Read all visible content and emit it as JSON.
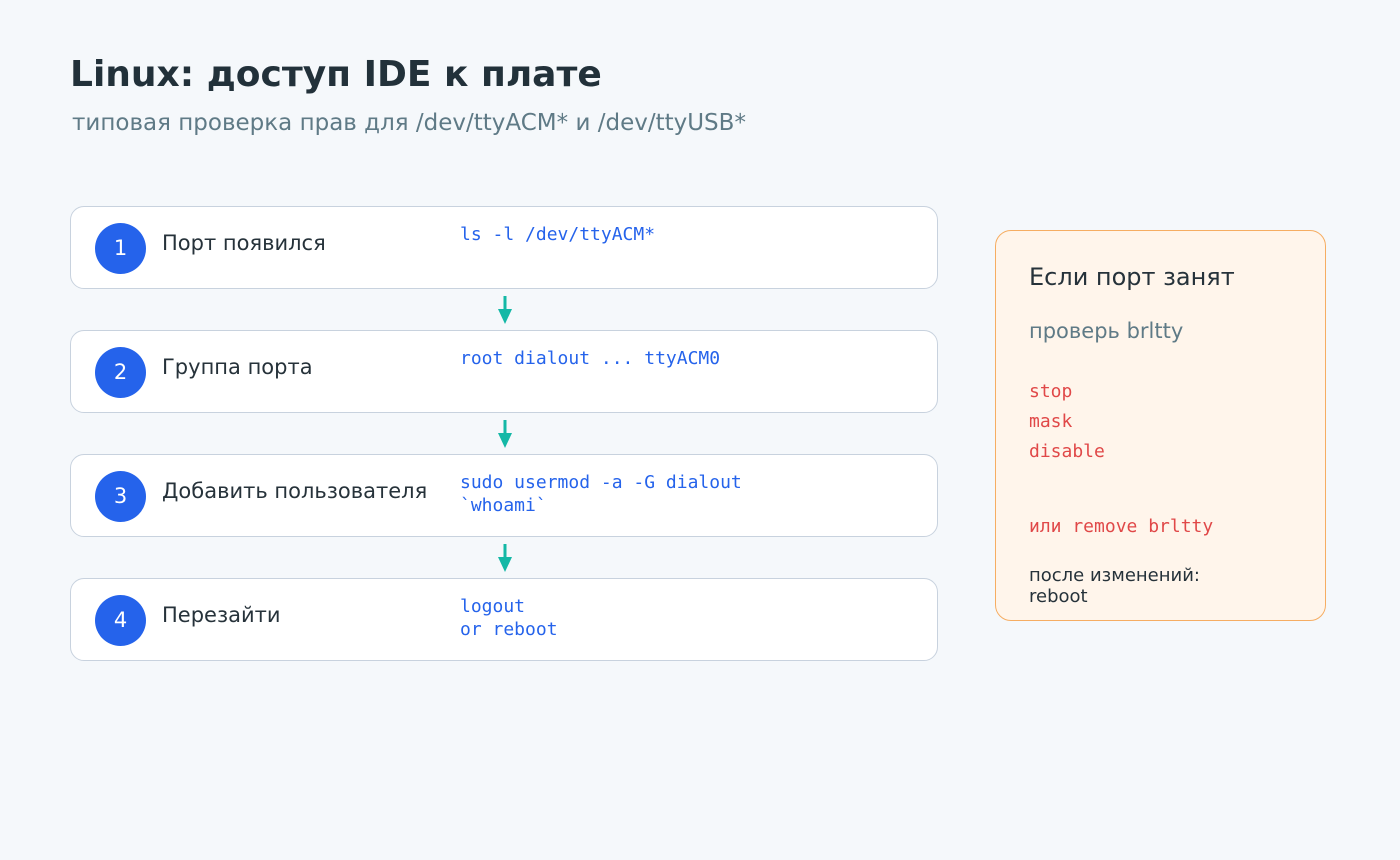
{
  "header": {
    "title": "Linux: доступ IDE к плате",
    "subtitle": "типовая проверка прав для /dev/ttyACM* и /dev/ttyUSB*"
  },
  "steps": [
    {
      "number": "1",
      "label": "Порт появился",
      "code": "ls -l /dev/ttyACM*"
    },
    {
      "number": "2",
      "label": "Группа порта",
      "code": "root dialout ... ttyACM0"
    },
    {
      "number": "3",
      "label": "Добавить пользователя",
      "code": "sudo usermod -a -G dialout\n`whoami`"
    },
    {
      "number": "4",
      "label": "Перезайти",
      "code": "logout\nor reboot"
    }
  ],
  "side_panel": {
    "title": "Если порт занят",
    "subtitle": "проверь brltty",
    "commands": [
      "stop",
      "mask",
      "disable"
    ],
    "alternative": "или remove brltty",
    "note": "после изменений:\nreboot"
  },
  "colors": {
    "accent": "#2563eb",
    "arrow": "#14b8a6",
    "warning_border": "#f6ad62",
    "warning_text": "#e04848",
    "background": "#f5f8fb"
  }
}
